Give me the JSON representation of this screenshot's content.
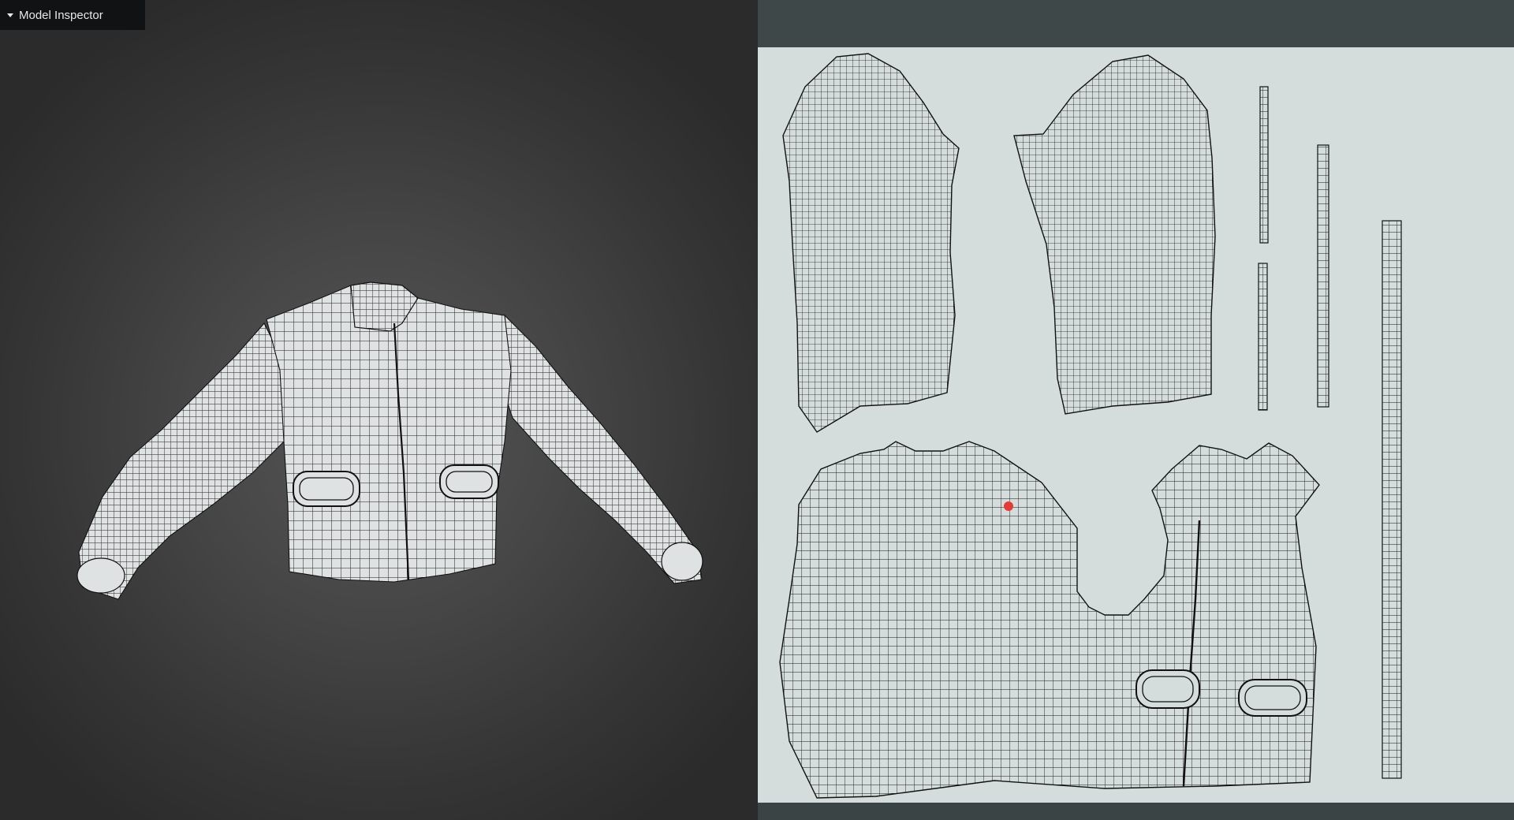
{
  "app": {
    "panel_title": "Model Inspector"
  },
  "icons": {
    "panel_toggle": "caret-down-icon"
  },
  "colors": {
    "viewport_bg": "#464646",
    "uv_panel_bg": "#3f4848",
    "uv_canvas_bg": "#d5dcdc",
    "mesh_fill": "#dfe2e2",
    "mesh_wire": "#111111",
    "selected_vertex": "#e53935"
  }
}
